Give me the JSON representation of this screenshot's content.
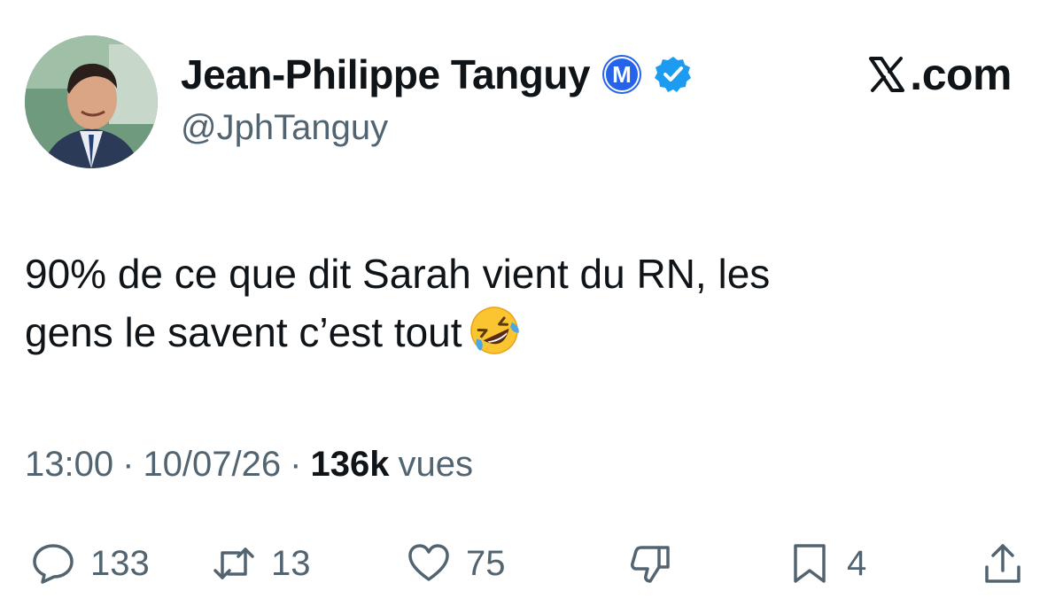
{
  "author": {
    "display_name": "Jean-Philippe Tanguy",
    "handle": "@JphTanguy",
    "badge_letter": "M",
    "verified": true
  },
  "brand": {
    "text": ".com"
  },
  "tweet": {
    "line1": "90% de ce que dit Sarah vient du RN, les",
    "line2": "gens le savent c’est tout",
    "emoji": "rolling-on-the-floor-laughing"
  },
  "meta": {
    "time": "13:00",
    "separator": "·",
    "date": "10/07/26",
    "views_count": "136k",
    "views_label": "vues"
  },
  "actions": {
    "replies": "133",
    "reposts": "13",
    "likes": "75",
    "bookmarks": "4"
  },
  "colors": {
    "text": "#0f1419",
    "secondary": "#536471",
    "verified_blue": "#1d9bf0",
    "m_badge_blue": "#2563eb"
  },
  "icons": {
    "reply": "speech-bubble-icon",
    "repost": "repost-arrows-icon",
    "like": "heart-icon",
    "dislike": "thumbs-down-icon",
    "bookmark": "bookmark-icon",
    "share": "share-upload-icon"
  }
}
